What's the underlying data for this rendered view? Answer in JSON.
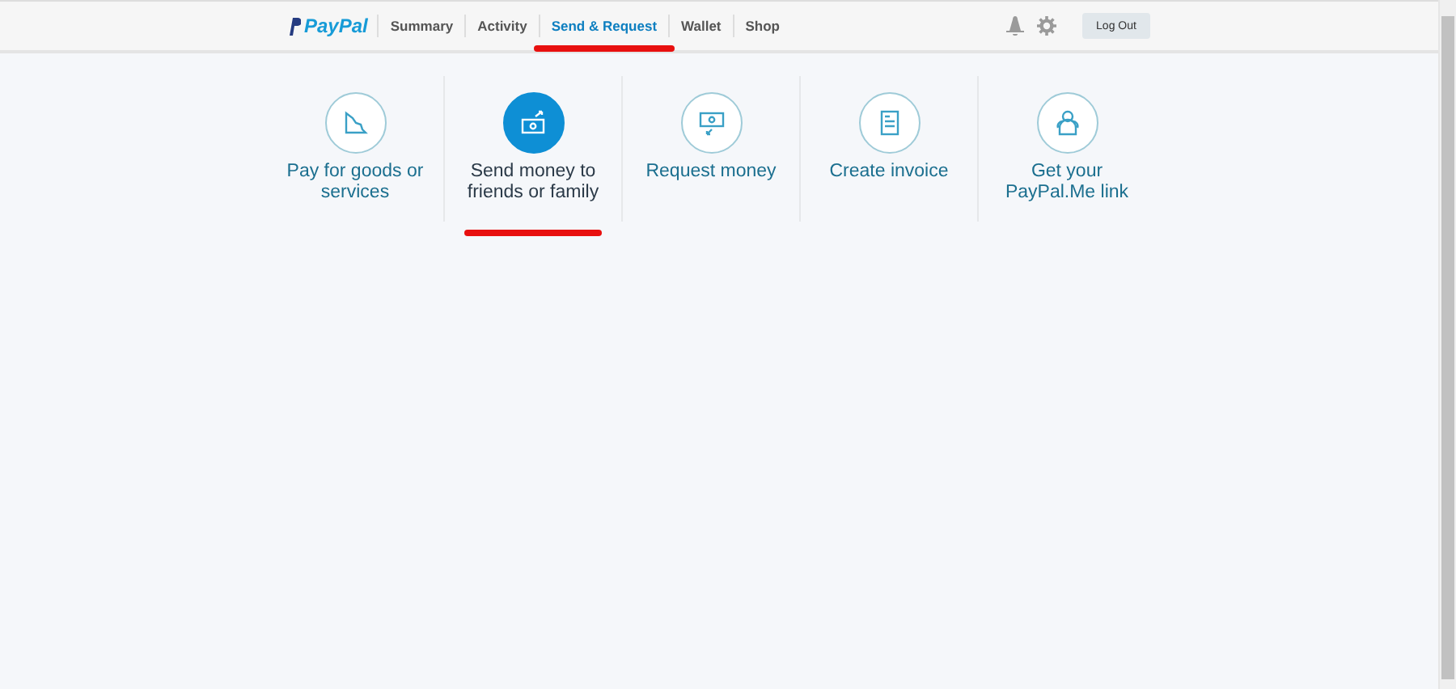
{
  "header": {
    "logo": "PayPal",
    "nav": [
      {
        "label": "Summary",
        "selected": false
      },
      {
        "label": "Activity",
        "selected": false
      },
      {
        "label": "Send & Request",
        "selected": true
      },
      {
        "label": "Wallet",
        "selected": false
      },
      {
        "label": "Shop",
        "selected": false
      }
    ],
    "logout": "Log Out"
  },
  "actions": [
    {
      "kind": "pay",
      "label": "Pay for goods or services",
      "selected": false
    },
    {
      "kind": "send",
      "label": "Send money to friends or family",
      "selected": true
    },
    {
      "kind": "request",
      "label": "Request money",
      "selected": false
    },
    {
      "kind": "invoice",
      "label": "Create invoice",
      "selected": false
    },
    {
      "kind": "paypalme",
      "label": "Get your PayPal.Me link",
      "selected": false
    }
  ]
}
